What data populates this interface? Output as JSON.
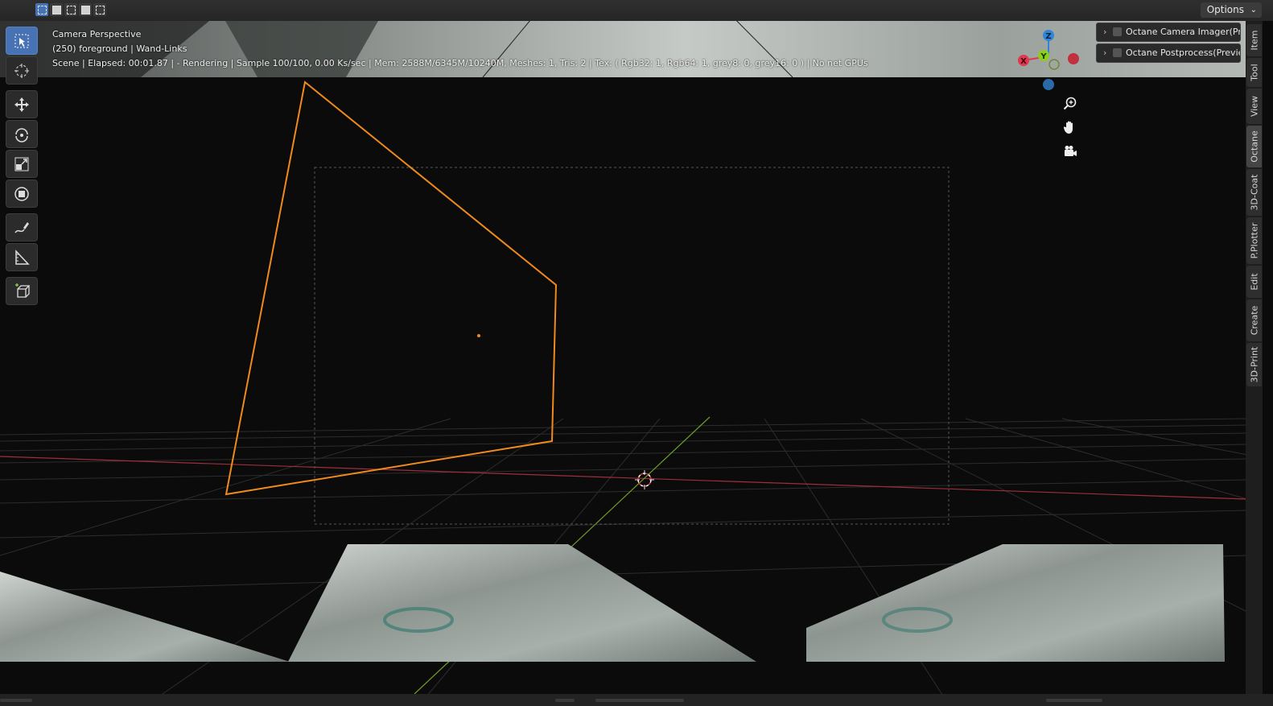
{
  "header": {
    "options_label": "Options",
    "select_modes": [
      "select-new-icon",
      "select-extend-icon",
      "select-subtract-icon",
      "select-invert-icon",
      "select-intersect-icon"
    ]
  },
  "viewport_info": {
    "line1": "Camera Perspective",
    "line2": "(250) foreground | Wand-Links",
    "line3": "Scene | Elapsed: 00:01.87 |  - Rendering | Sample 100/100, 0.00 Ks/sec | Mem: 2588M/6345M/10240M, Meshes: 1, Tris: 2 | Tex: ( Rgb32: 1, Rgb64: 1, grey8: 0, grey16: 0 ) | No net GPUs"
  },
  "toolbar": {
    "tools": [
      "select-box-icon",
      "cursor-icon",
      "move-icon",
      "rotate-icon",
      "scale-icon",
      "transform-icon",
      "annotate-icon",
      "measure-icon",
      "add-cube-icon"
    ],
    "active_tool": "select-box-icon"
  },
  "gizmo": {
    "x": "X",
    "y": "Y",
    "z": "Z",
    "colors": {
      "x": "#e0384f",
      "y": "#8bce1c",
      "z": "#2f86d8"
    }
  },
  "nav_buttons": [
    "zoom-icon",
    "pan-hand-icon",
    "camera-view-icon"
  ],
  "panels": [
    {
      "label": "Octane Camera Imager(Previ"
    },
    {
      "label": "Octane Postprocess(Preview"
    }
  ],
  "side_tabs": [
    "Item",
    "Tool",
    "View",
    "Octane",
    "3D-Coat",
    "P.Plotter",
    "Edit",
    "Create",
    "3D-Print"
  ],
  "active_side_tab": "Octane",
  "colors": {
    "selection_outline": "#f08a1c",
    "accent_blue": "#4772b3",
    "x_axis_line": "#9c2f3c",
    "y_axis_line": "#6e9a26"
  }
}
